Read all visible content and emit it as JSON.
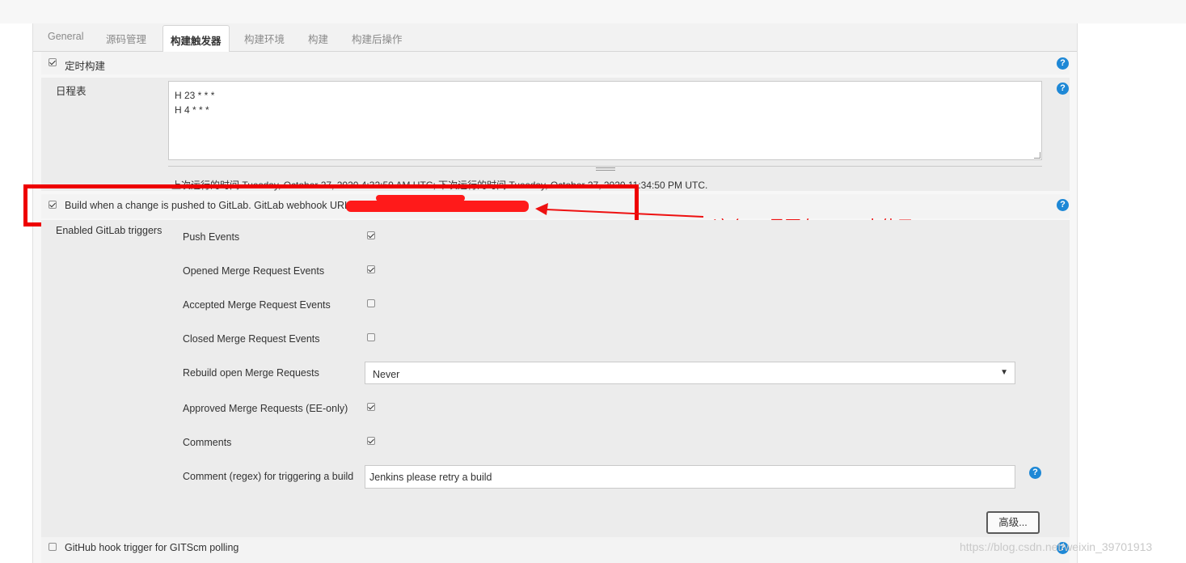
{
  "tabs": [
    {
      "label": "General",
      "active": false
    },
    {
      "label": "源码管理",
      "active": false
    },
    {
      "label": "构建触发器",
      "active": true
    },
    {
      "label": "构建环境",
      "active": false
    },
    {
      "label": "构建",
      "active": false
    },
    {
      "label": "构建后操作",
      "active": false
    }
  ],
  "build_periodically": {
    "label": "定时构建",
    "checked": true,
    "schedule_label": "日程表",
    "schedule_value": "H 23 * * *\nH 4 * * *",
    "run_info": "上次运行的时间 Tuesday, October 27, 2020 4:32:50 AM UTC; 下次运行的时间 Tuesday, October 27, 2020 11:34:50 PM UTC."
  },
  "gitlab": {
    "label": "Build when a change is pushed to GitLab. GitLab webhook URL",
    "checked": true,
    "triggers_label": "Enabled GitLab triggers",
    "events": [
      {
        "label": "Push Events",
        "checked": true
      },
      {
        "label": "Opened Merge Request Events",
        "checked": true
      },
      {
        "label": "Accepted Merge Request Events",
        "checked": false
      },
      {
        "label": "Closed Merge Request Events",
        "checked": false
      }
    ],
    "rebuild_label": "Rebuild open Merge Requests",
    "rebuild_value": "Never",
    "approved_label": "Approved Merge Requests (EE-only)",
    "approved_checked": true,
    "comments_label": "Comments",
    "comments_checked": true,
    "comment_regex_label": "Comment (regex) for triggering a build",
    "comment_regex_value": "Jenkins please retry a build",
    "advanced_button": "高级..."
  },
  "github_hook": {
    "label": "GitHub hook trigger for GITScm polling",
    "checked": false
  },
  "annotation": {
    "text": "这个url是要在gitlab中使用",
    "color": "#ee1111"
  },
  "watermark": "https://blog.csdn.net/weixin_39701913",
  "icons": {
    "help": "help-icon",
    "help_glyph": "?",
    "select_arrow": "▼"
  },
  "colors": {
    "help_blue": "#1e88d6",
    "highlight_red": "#ee0000"
  }
}
